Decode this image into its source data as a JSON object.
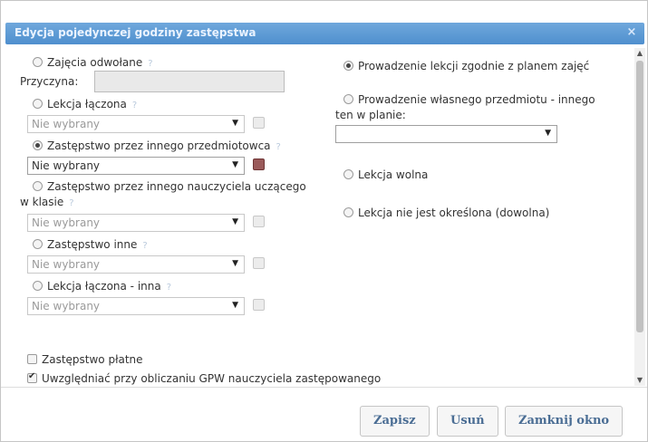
{
  "dialog": {
    "title": "Edycja pojedynczej godziny zastępstwa",
    "close_label": "×"
  },
  "left": {
    "canceled_label": "Zajęcia odwołane",
    "reason_label": "Przyczyna:",
    "reason_value": "",
    "combined_label": "Lekcja łączona",
    "combined_select": "Nie wybrany",
    "other_subject_teacher_label": "Zastępstwo przez innego przedmiotowca",
    "other_subject_teacher_select": "Nie wybrany",
    "class_teacher_label_line1": "Zastępstwo przez innego nauczyciela uczącego",
    "class_teacher_label_line2": "w klasie",
    "class_teacher_select": "Nie wybrany",
    "other_substitution_label": "Zastępstwo inne",
    "other_substitution_select": "Nie wybrany",
    "combined_other_label": "Lekcja łączona - inna",
    "combined_other_select": "Nie wybrany",
    "paid_label": "Zastępstwo płatne",
    "gpw_label": "Uwzględniać przy obliczaniu GPW nauczyciela zastępowanego"
  },
  "right": {
    "per_plan_label": "Prowadzenie lekcji zgodnie z planem zajęć",
    "own_subject_label_line1": "Prowadzenie własnego przedmiotu - innego",
    "own_subject_label_line2": "ten w planie:",
    "own_subject_select": "",
    "free_lesson_label": "Lekcja wolna",
    "undetermined_label": "Lekcja nie jest określona (dowolna)"
  },
  "footer": {
    "save_label": "Zapisz",
    "delete_label": "Usuń",
    "close_window_label": "Zamknij okno"
  },
  "icons": {
    "help": "question-mark",
    "picker": "list-picker",
    "caret": "dropdown-caret"
  }
}
